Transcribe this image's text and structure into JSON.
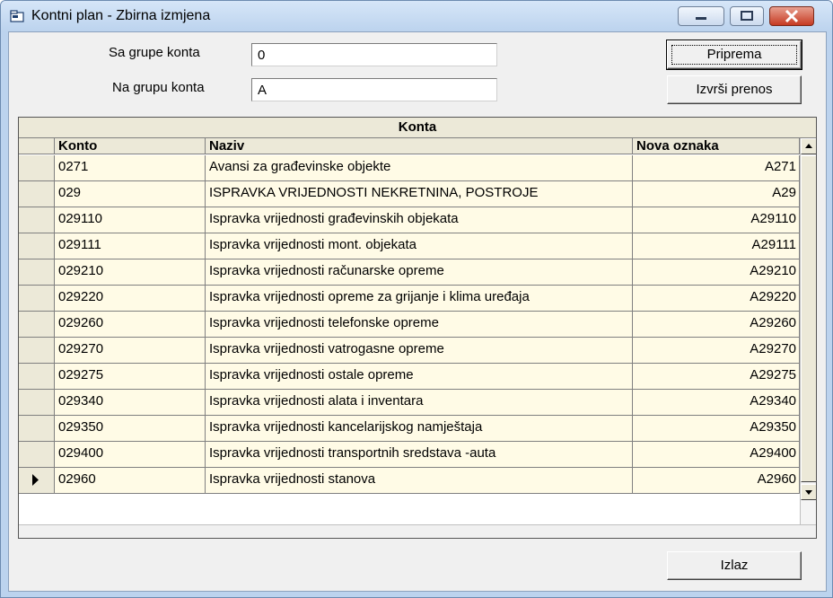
{
  "window": {
    "title": "Kontni plan - Zbirna izmjena"
  },
  "form": {
    "from_label": "Sa grupe konta",
    "from_value": "0",
    "to_label": "Na grupu konta",
    "to_value": "A",
    "prepare_button": "Priprema",
    "execute_button": "Izvrši prenos",
    "exit_button": "Izlaz"
  },
  "grid": {
    "caption": "Konta",
    "columns": [
      "Konto",
      "Naziv",
      "Nova oznaka"
    ],
    "rows": [
      {
        "konto": "0271",
        "naziv": "Avansi za građevinske objekte",
        "nova": "A271"
      },
      {
        "konto": "029",
        "naziv": "ISPRAVKA VRIJEDNOSTI NEKRETNINA, POSTROJE",
        "nova": "A29"
      },
      {
        "konto": "029110",
        "naziv": "Ispravka vrijednosti građevinskih objekata",
        "nova": "A29110"
      },
      {
        "konto": "029111",
        "naziv": "Ispravka vrijednosti mont. objekata",
        "nova": "A29111"
      },
      {
        "konto": "029210",
        "naziv": "Ispravka vrijednosti računarske opreme",
        "nova": "A29210"
      },
      {
        "konto": "029220",
        "naziv": "Ispravka vrijednosti opreme za grijanje i klima uređaja",
        "nova": "A29220"
      },
      {
        "konto": "029260",
        "naziv": "Ispravka vrijednosti telefonske opreme",
        "nova": "A29260"
      },
      {
        "konto": "029270",
        "naziv": "Ispravka vrijednosti vatrogasne opreme",
        "nova": "A29270"
      },
      {
        "konto": "029275",
        "naziv": "Ispravka vrijednosti ostale opreme",
        "nova": "A29275"
      },
      {
        "konto": "029340",
        "naziv": "Ispravka vrijednosti alata i inventara",
        "nova": "A29340"
      },
      {
        "konto": "029350",
        "naziv": "Ispravka vrijednosti kancelarijskog namještaja",
        "nova": "A29350"
      },
      {
        "konto": "029400",
        "naziv": "Ispravka vrijednosti transportnih sredstava -auta",
        "nova": "A29400"
      },
      {
        "konto": "02960",
        "naziv": "Ispravka vrijednosti stanova",
        "nova": "A2960"
      }
    ],
    "current_row_index": 12
  }
}
